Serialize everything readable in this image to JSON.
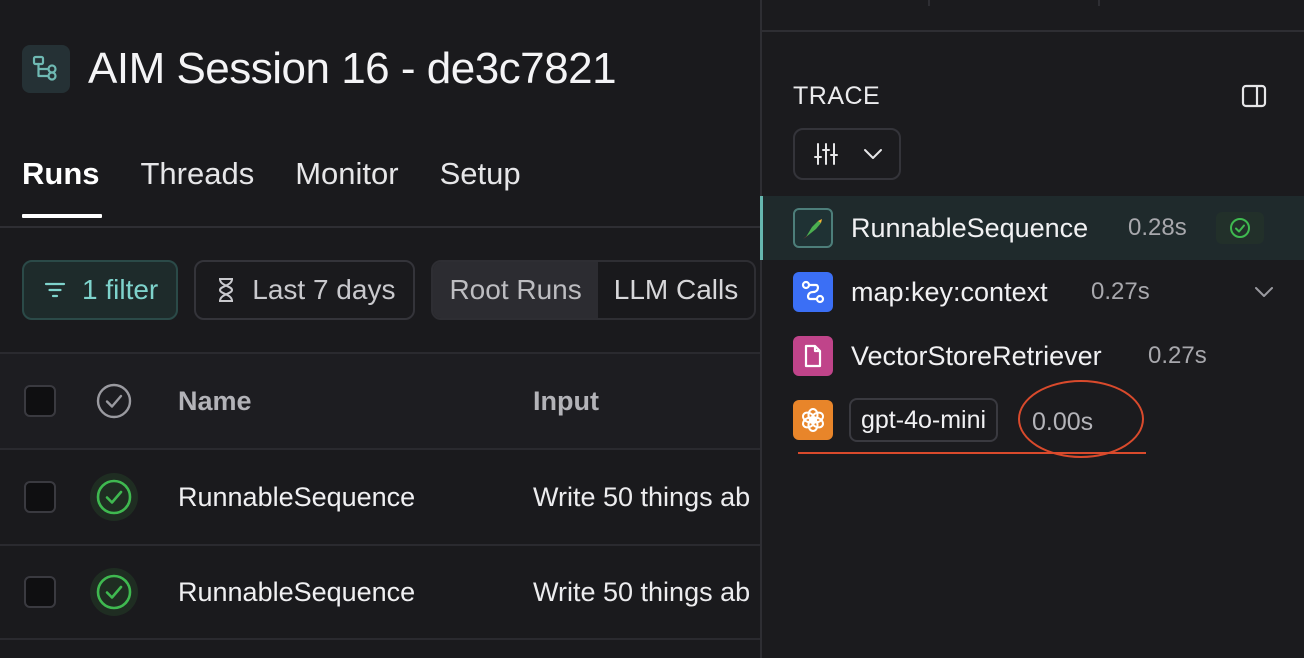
{
  "page": {
    "title": "AIM Session 16 - de3c7821"
  },
  "tabs": [
    {
      "label": "Runs",
      "active": true
    },
    {
      "label": "Threads",
      "active": false
    },
    {
      "label": "Monitor",
      "active": false
    },
    {
      "label": "Setup",
      "active": false
    }
  ],
  "filters": {
    "filter_chip": "1 filter",
    "date_chip": "Last 7 days",
    "segments": [
      "Root Runs",
      "LLM Calls"
    ],
    "selected_segment": "Root Runs"
  },
  "table": {
    "headers": {
      "name": "Name",
      "input": "Input"
    },
    "rows": [
      {
        "name": "RunnableSequence",
        "input": "Write 50 things ab",
        "status": "success"
      },
      {
        "name": "RunnableSequence",
        "input": "Write 50 things ab",
        "status": "success"
      }
    ]
  },
  "trace": {
    "label": "TRACE",
    "nodes": [
      {
        "name": "RunnableSequence",
        "time": "0.28s",
        "icon": "parrot-icon",
        "status": "success",
        "selected": true
      },
      {
        "name": "map:key:context",
        "time": "0.27s",
        "icon": "map-icon",
        "expandable": true
      },
      {
        "name": "VectorStoreRetriever",
        "time": "0.27s",
        "icon": "document-icon"
      },
      {
        "name": "gpt-4o-mini",
        "time": "0.00s",
        "icon": "openai-icon"
      }
    ]
  },
  "colors": {
    "accent_teal": "#7ed3cc",
    "success_green": "#3fb950",
    "map_blue": "#3b6ff5",
    "retriever_pink": "#c0448a",
    "openai_orange": "#e8852a",
    "annotation_red": "#d94a2c"
  }
}
